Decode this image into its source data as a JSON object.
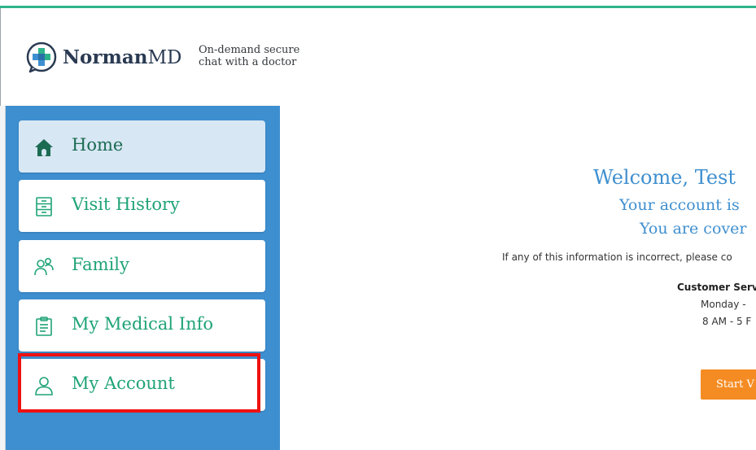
{
  "header": {
    "logo_bold": "Norman",
    "logo_light": "MD",
    "tagline_line1": "On-demand secure",
    "tagline_line2": "chat with a doctor"
  },
  "sidebar": {
    "items": [
      {
        "label": "Home",
        "icon": "home-icon",
        "active": true
      },
      {
        "label": "Visit History",
        "icon": "filing-cabinet-icon",
        "active": false
      },
      {
        "label": "Family",
        "icon": "family-icon",
        "active": false
      },
      {
        "label": "My Medical Info",
        "icon": "clipboard-icon",
        "active": false
      },
      {
        "label": "My Account",
        "icon": "user-icon",
        "active": false,
        "highlighted": true
      }
    ]
  },
  "main": {
    "welcome": "Welcome, Test",
    "status_line1": "Your account is",
    "status_line2": "You are cover",
    "info_text": "If any of this information is incorrect, please co",
    "customer_service_title": "Customer Serv",
    "customer_service_days": "Monday -",
    "customer_service_hours": "8 AM - 5 F",
    "start_button": "Start V"
  },
  "colors": {
    "brand_green": "#1fa377",
    "sidebar_blue": "#3e8fd0",
    "heading_blue": "#3f8fcf",
    "button_orange": "#f58c23",
    "highlight_red": "#ee1111"
  }
}
